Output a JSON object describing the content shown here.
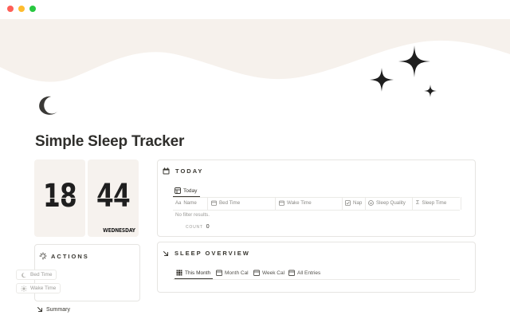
{
  "page": {
    "title": "Simple Sleep Tracker"
  },
  "clock": {
    "hour": "18",
    "minute": "44",
    "weekday": "WEDNESDAY"
  },
  "actions": {
    "title": "ACTIONS",
    "buttons": [
      {
        "label": "Bed Time",
        "icon": "moon-icon"
      },
      {
        "label": "Wake Time",
        "icon": "sun-icon"
      }
    ]
  },
  "summary": {
    "label": "Summary"
  },
  "today": {
    "title": "TODAY",
    "tabs": [
      {
        "label": "Today",
        "icon": "table-icon"
      }
    ],
    "columns": [
      {
        "label": "Name",
        "icon": "text-icon"
      },
      {
        "label": "Bed Time",
        "icon": "calendar-icon"
      },
      {
        "label": "Wake Time",
        "icon": "calendar-icon"
      },
      {
        "label": "Nap",
        "icon": "checkbox-icon"
      },
      {
        "label": "Sleep Quality",
        "icon": "select-icon"
      },
      {
        "label": "Sleep Time",
        "icon": "formula-icon"
      }
    ],
    "empty_text": "No filter results.",
    "count_label": "COUNT",
    "count_value": "0"
  },
  "overview": {
    "title": "SLEEP OVERVIEW",
    "tabs": [
      {
        "label": "This Month",
        "icon": "grid-icon"
      },
      {
        "label": "Month Cal",
        "icon": "calendar-icon"
      },
      {
        "label": "Week Cal",
        "icon": "calendar-icon"
      },
      {
        "label": "All Entries",
        "icon": "calendar-icon"
      }
    ]
  },
  "colors": {
    "cover": "#f6f1ec",
    "clock_bg": "#f6f2ee",
    "border": "#e6e5e2",
    "text": "#37352f",
    "muted": "#9b9a97"
  }
}
